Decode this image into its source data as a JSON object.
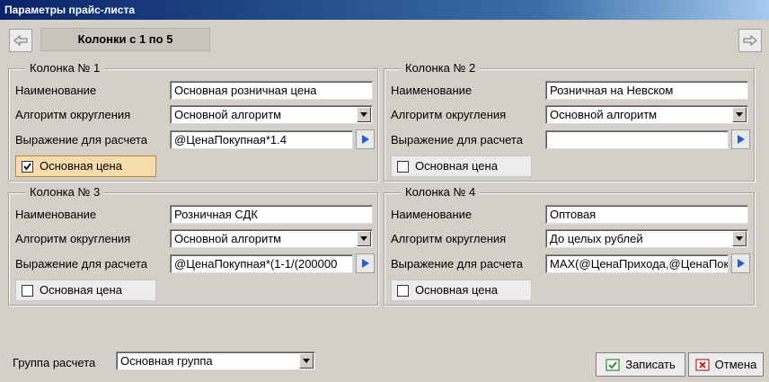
{
  "window": {
    "title": "Параметры прайс-листа"
  },
  "columns_range": "Колонки с 1 по 5",
  "common_labels": {
    "name": "Наименование",
    "algorithm": "Алгоритм округления",
    "expression": "Выражение для расчета",
    "main_price": "Основная цена"
  },
  "panels": [
    {
      "title": "Колонка № 1",
      "name": "Основная розничная цена",
      "algorithm": "Основной алгоритм",
      "expression": "@ЦенаПокупная*1.4",
      "main_price": true
    },
    {
      "title": "Колонка № 2",
      "name": "Розничная на Невском",
      "algorithm": "Основной алгоритм",
      "expression": "",
      "main_price": false
    },
    {
      "title": "Колонка № 3",
      "name": "Розничная СДК",
      "algorithm": "Основной алгоритм",
      "expression": "@ЦенаПокупная*(1-1/(200000",
      "main_price": false
    },
    {
      "title": "Колонка № 4",
      "name": "Оптовая",
      "algorithm": "До целых рублей",
      "expression": "MAX(@ЦенаПрихода,@ЦенаПок",
      "main_price": false
    }
  ],
  "group": {
    "label": "Группа расчета",
    "value": "Основная группа"
  },
  "buttons": {
    "save": "Записать",
    "cancel": "Отмена"
  },
  "colors": {
    "accent_check": "#f5dcaa",
    "title_bar": "#0a246a",
    "background": "#d4d0c8"
  }
}
